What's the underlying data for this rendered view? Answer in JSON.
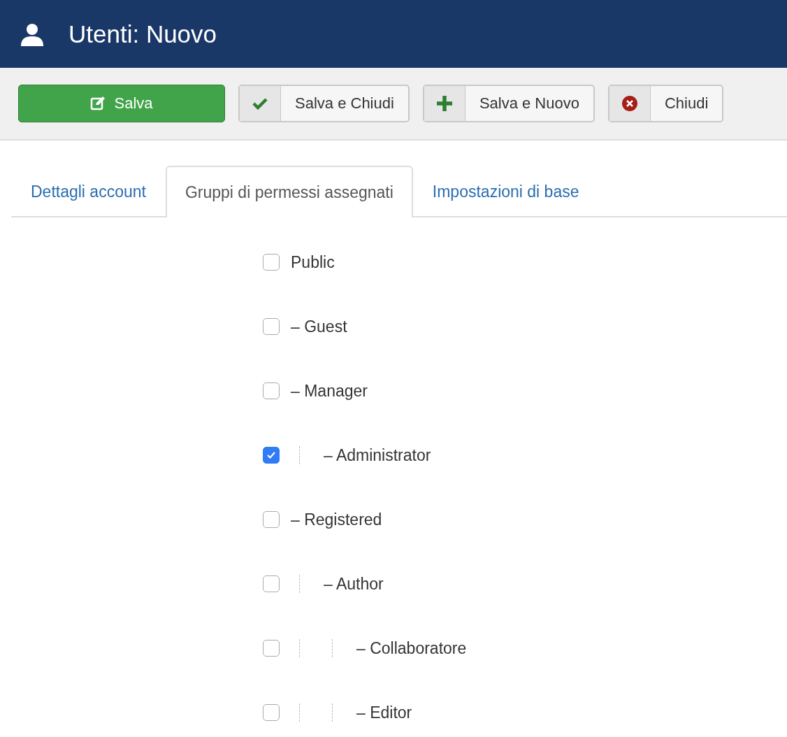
{
  "header": {
    "title": "Utenti: Nuovo"
  },
  "toolbar": [
    {
      "kind": "save",
      "label": "Salva"
    },
    {
      "kind": "save-close",
      "label": "Salva e Chiudi"
    },
    {
      "kind": "save-new",
      "label": "Salva e Nuovo"
    },
    {
      "kind": "close",
      "label": "Chiudi"
    }
  ],
  "tabs": [
    {
      "label": "Dettagli account",
      "selected": false
    },
    {
      "label": "Gruppi di permessi assegnati",
      "selected": true
    },
    {
      "label": "Impostazioni di base",
      "selected": false
    }
  ],
  "groups": [
    {
      "label": "Public",
      "checked": false,
      "children": [
        {
          "label": "– Guest",
          "checked": false
        },
        {
          "label": "– Manager",
          "checked": false,
          "children": [
            {
              "label": "– Administrator",
              "checked": true
            }
          ]
        },
        {
          "label": "– Registered",
          "checked": false,
          "children": [
            {
              "label": "– Author",
              "checked": false,
              "children": [
                {
                  "label": "– Collaboratore",
                  "checked": false
                },
                {
                  "label": "– Editor",
                  "checked": false
                }
              ]
            }
          ]
        }
      ]
    }
  ]
}
